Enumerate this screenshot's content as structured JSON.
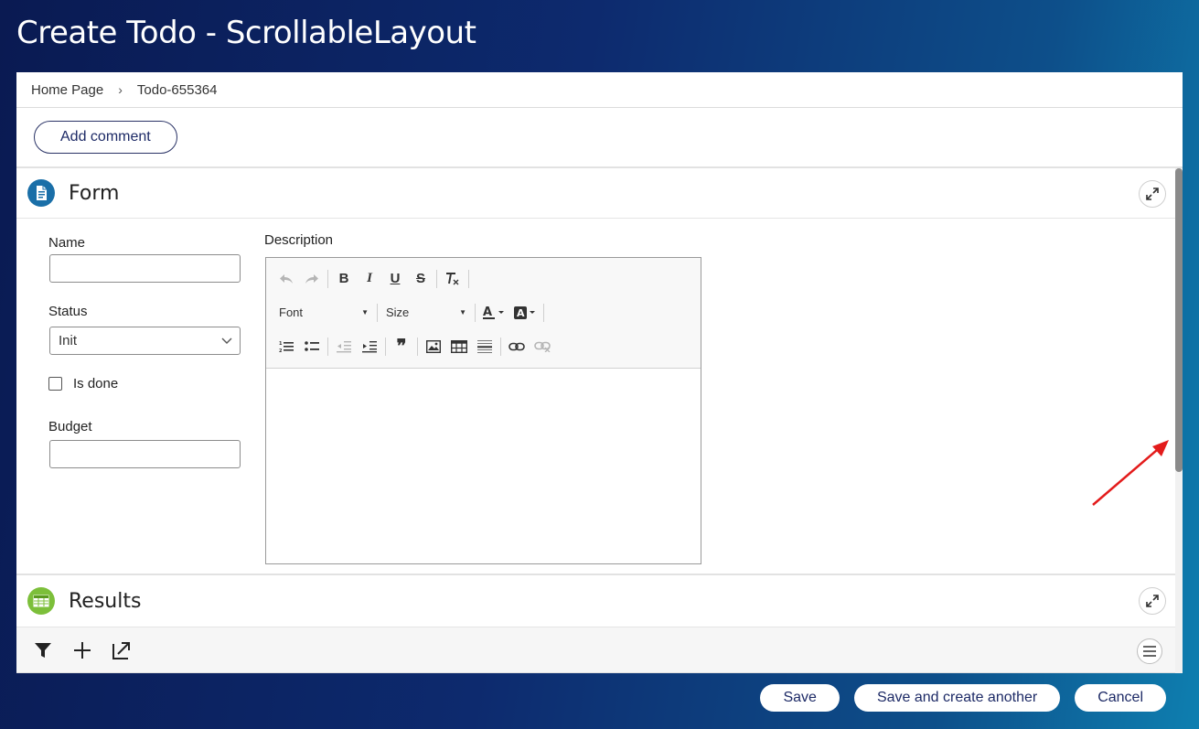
{
  "window": {
    "title": "Create Todo - ScrollableLayout"
  },
  "breadcrumb": {
    "items": [
      "Home Page",
      "Todo-655364"
    ],
    "separator": "›"
  },
  "actions": {
    "add_comment": "Add comment"
  },
  "form_section": {
    "title": "Form",
    "icon": "document-icon",
    "fields": {
      "name": {
        "label": "Name",
        "value": ""
      },
      "status": {
        "label": "Status",
        "value": "Init"
      },
      "is_done": {
        "label": "Is done",
        "checked": false
      },
      "budget": {
        "label": "Budget",
        "value": ""
      },
      "description": {
        "label": "Description",
        "value": ""
      }
    },
    "editor": {
      "font_label": "Font",
      "size_label": "Size"
    }
  },
  "results_section": {
    "title": "Results",
    "icon": "table-icon"
  },
  "footer": {
    "save": "Save",
    "save_and_create": "Save and create another",
    "cancel": "Cancel"
  },
  "colors": {
    "accent": "#1d2a66",
    "form_icon_bg": "#1a6fa8",
    "results_icon_bg": "#7cbf3a",
    "annotation_arrow": "#e31b1b"
  }
}
